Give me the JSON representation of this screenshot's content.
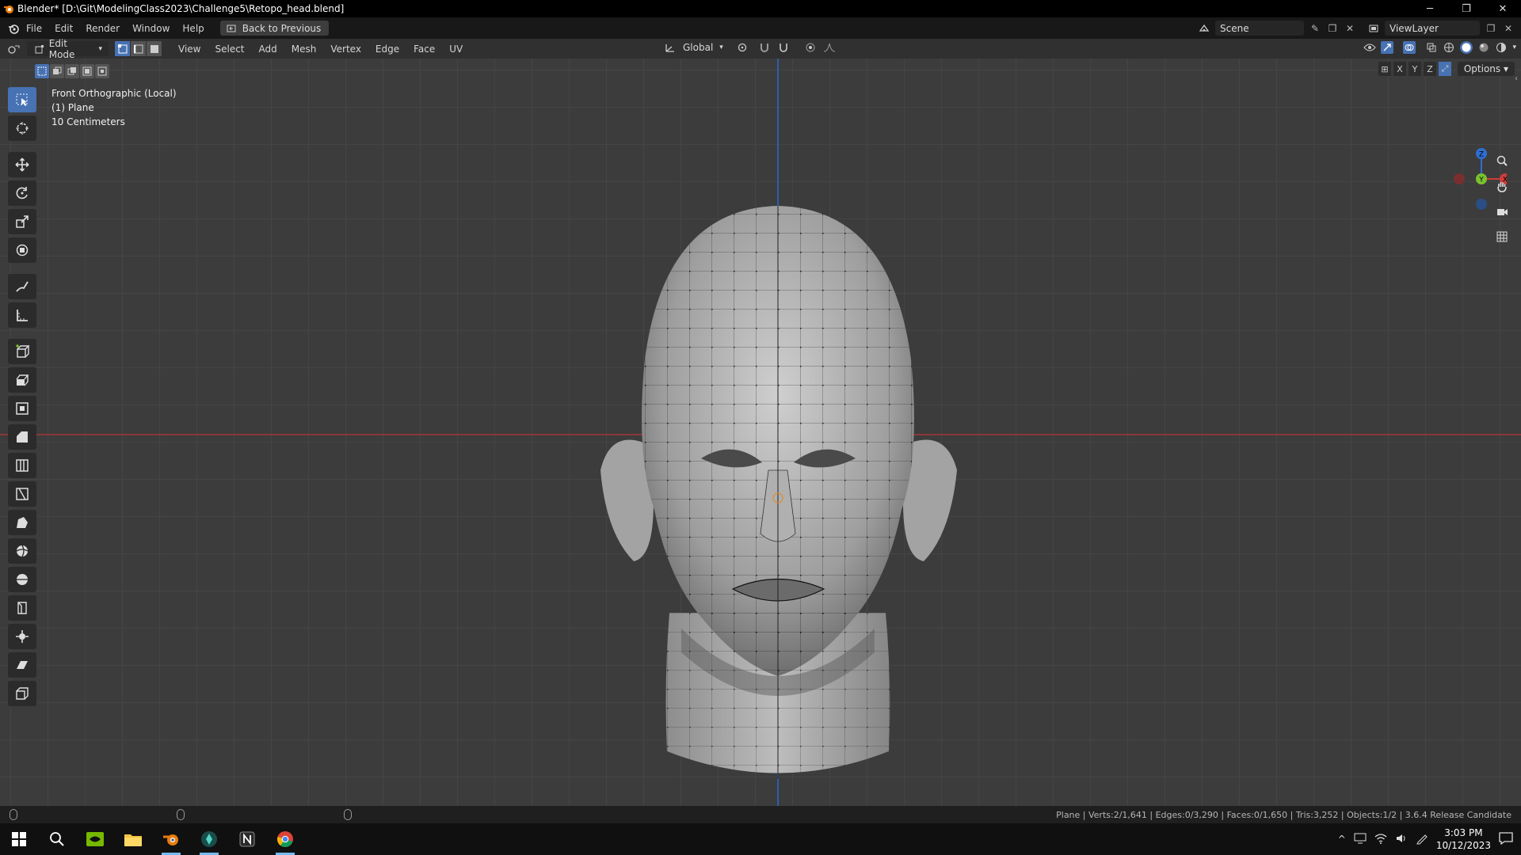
{
  "window": {
    "title": "Blender* [D:\\Git\\ModelingClass2023\\Challenge5\\Retopo_head.blend]",
    "controls": [
      "─",
      "❐",
      "✕"
    ]
  },
  "topbar": {
    "menus": [
      "File",
      "Edit",
      "Render",
      "Window",
      "Help"
    ],
    "back_button": "Back to Previous",
    "scene": "Scene",
    "view_layer": "ViewLayer"
  },
  "viewport_header": {
    "mode": "Edit Mode",
    "menus": [
      "View",
      "Select",
      "Add",
      "Mesh",
      "Vertex",
      "Edge",
      "Face",
      "UV"
    ],
    "transform_orientation": "Global"
  },
  "viewport": {
    "view_name": "Front Orthographic (Local)",
    "object_name": "(1) Plane",
    "scale": "10 Centimeters",
    "axis_lock": [
      "X",
      "Y",
      "Z"
    ],
    "options_label": "Options",
    "gizmo": {
      "z": "Z",
      "y": "Y",
      "x": "X"
    }
  },
  "statusbar": {
    "stats": "Plane | Verts:2/1,641 | Edges:0/3,290 | Faces:0/1,650 | Tris:3,252 | Objects:1/2 | 3.6.4 Release Candidate"
  },
  "taskbar": {
    "time": "3:03 PM",
    "date": "10/12/2023"
  },
  "colors": {
    "accent": "#4772b3",
    "x_axis": "#8a3737",
    "z_axis": "#2b5fa8"
  }
}
